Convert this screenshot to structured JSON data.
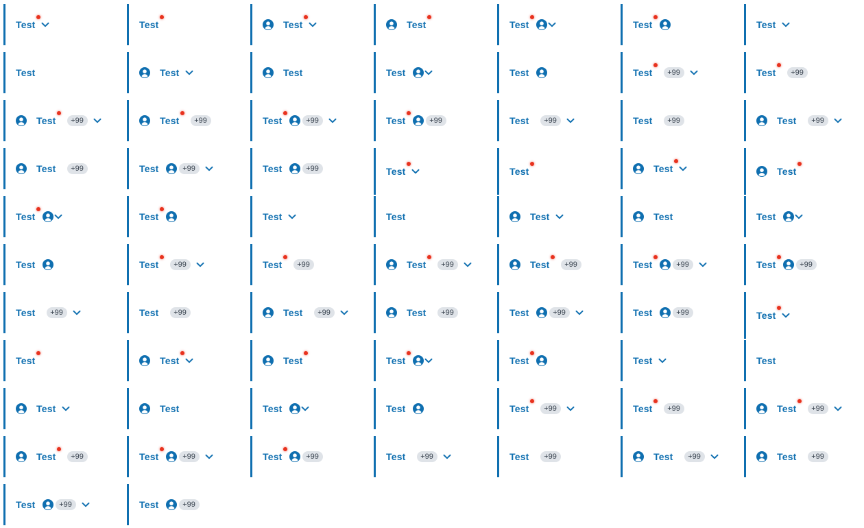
{
  "colors": {
    "accent": "#0f6fb0",
    "notification_dot": "#e8321e",
    "badge_bg": "#dfe3e8",
    "badge_text": "#3a4450"
  },
  "icons": {
    "avatar": "user-avatar-icon",
    "chevron": "chevron-down-icon",
    "dot": "notification-dot"
  },
  "tabs": [
    {
      "label": "Test",
      "dot": true,
      "avatar": null,
      "badge": null,
      "chevron": true
    },
    {
      "label": "Test",
      "dot": true,
      "avatar": null,
      "badge": null,
      "chevron": false
    },
    {
      "label": "Test",
      "dot": true,
      "avatar": "before",
      "badge": null,
      "chevron": true
    },
    {
      "label": "Test",
      "dot": true,
      "avatar": "before",
      "badge": null,
      "chevron": false
    },
    {
      "label": "Test",
      "dot": true,
      "avatar": "after",
      "badge": null,
      "chevron": true
    },
    {
      "label": "Test",
      "dot": true,
      "avatar": "after",
      "badge": null,
      "chevron": false
    },
    {
      "label": "Test",
      "dot": false,
      "avatar": null,
      "badge": null,
      "chevron": true
    },
    {
      "label": "Test",
      "dot": false,
      "avatar": null,
      "badge": null,
      "chevron": false
    },
    {
      "label": "Test",
      "dot": false,
      "avatar": "before",
      "badge": null,
      "chevron": true
    },
    {
      "label": "Test",
      "dot": false,
      "avatar": "before",
      "badge": null,
      "chevron": false
    },
    {
      "label": "Test",
      "dot": false,
      "avatar": "after",
      "badge": null,
      "chevron": true
    },
    {
      "label": "Test",
      "dot": false,
      "avatar": "after",
      "badge": null,
      "chevron": false
    },
    {
      "label": "Test",
      "dot": true,
      "avatar": null,
      "badge": "+99",
      "chevron": true
    },
    {
      "label": "Test",
      "dot": true,
      "avatar": null,
      "badge": "+99",
      "chevron": false
    },
    {
      "label": "Test",
      "dot": true,
      "avatar": "before",
      "badge": "+99",
      "chevron": true
    },
    {
      "label": "Test",
      "dot": true,
      "avatar": "before",
      "badge": "+99",
      "chevron": false
    },
    {
      "label": "Test",
      "dot": true,
      "avatar": "after",
      "badge": "+99",
      "chevron": true
    },
    {
      "label": "Test",
      "dot": true,
      "avatar": "after",
      "badge": "+99",
      "chevron": false
    },
    {
      "label": "Test",
      "dot": false,
      "avatar": null,
      "badge": "+99",
      "chevron": true
    },
    {
      "label": "Test",
      "dot": false,
      "avatar": null,
      "badge": "+99",
      "chevron": false
    },
    {
      "label": "Test",
      "dot": false,
      "avatar": "before",
      "badge": "+99",
      "chevron": true
    },
    {
      "label": "Test",
      "dot": false,
      "avatar": "before",
      "badge": "+99",
      "chevron": false
    },
    {
      "label": "Test",
      "dot": false,
      "avatar": "after",
      "badge": "+99",
      "chevron": true
    },
    {
      "label": "Test",
      "dot": false,
      "avatar": "after",
      "badge": "+99",
      "chevron": false
    },
    {
      "label": "Test",
      "dot": true,
      "avatar": null,
      "badge": null,
      "chevron": true
    },
    {
      "label": "Test",
      "dot": true,
      "avatar": null,
      "badge": null,
      "chevron": false
    },
    {
      "label": "Test",
      "dot": true,
      "avatar": "before",
      "badge": null,
      "chevron": true
    },
    {
      "label": "Test",
      "dot": true,
      "avatar": "before",
      "badge": null,
      "chevron": false
    },
    {
      "label": "Test",
      "dot": true,
      "avatar": "after",
      "badge": null,
      "chevron": true
    },
    {
      "label": "Test",
      "dot": true,
      "avatar": "after",
      "badge": null,
      "chevron": false
    },
    {
      "label": "Test",
      "dot": false,
      "avatar": null,
      "badge": null,
      "chevron": true
    },
    {
      "label": "Test",
      "dot": false,
      "avatar": null,
      "badge": null,
      "chevron": false
    },
    {
      "label": "Test",
      "dot": false,
      "avatar": "before",
      "badge": null,
      "chevron": true
    },
    {
      "label": "Test",
      "dot": false,
      "avatar": "before",
      "badge": null,
      "chevron": false
    },
    {
      "label": "Test",
      "dot": false,
      "avatar": "after",
      "badge": null,
      "chevron": true
    },
    {
      "label": "Test",
      "dot": false,
      "avatar": "after",
      "badge": null,
      "chevron": false
    },
    {
      "label": "Test",
      "dot": true,
      "avatar": null,
      "badge": "+99",
      "chevron": true
    },
    {
      "label": "Test",
      "dot": true,
      "avatar": null,
      "badge": "+99",
      "chevron": false
    },
    {
      "label": "Test",
      "dot": true,
      "avatar": "before",
      "badge": "+99",
      "chevron": true
    },
    {
      "label": "Test",
      "dot": true,
      "avatar": "before",
      "badge": "+99",
      "chevron": false
    },
    {
      "label": "Test",
      "dot": true,
      "avatar": "after",
      "badge": "+99",
      "chevron": true
    },
    {
      "label": "Test",
      "dot": true,
      "avatar": "after",
      "badge": "+99",
      "chevron": false
    },
    {
      "label": "Test",
      "dot": false,
      "avatar": null,
      "badge": "+99",
      "chevron": true
    },
    {
      "label": "Test",
      "dot": false,
      "avatar": null,
      "badge": "+99",
      "chevron": false
    },
    {
      "label": "Test",
      "dot": false,
      "avatar": "before",
      "badge": "+99",
      "chevron": true
    },
    {
      "label": "Test",
      "dot": false,
      "avatar": "before",
      "badge": "+99",
      "chevron": false
    },
    {
      "label": "Test",
      "dot": false,
      "avatar": "after",
      "badge": "+99",
      "chevron": true
    },
    {
      "label": "Test",
      "dot": false,
      "avatar": "after",
      "badge": "+99",
      "chevron": false
    },
    {
      "label": "Test",
      "dot": true,
      "avatar": null,
      "badge": null,
      "chevron": true
    },
    {
      "label": "Test",
      "dot": true,
      "avatar": null,
      "badge": null,
      "chevron": false
    },
    {
      "label": "Test",
      "dot": true,
      "avatar": "before",
      "badge": null,
      "chevron": true
    },
    {
      "label": "Test",
      "dot": true,
      "avatar": "before",
      "badge": null,
      "chevron": false
    },
    {
      "label": "Test",
      "dot": true,
      "avatar": "after",
      "badge": null,
      "chevron": true
    },
    {
      "label": "Test",
      "dot": true,
      "avatar": "after",
      "badge": null,
      "chevron": false
    },
    {
      "label": "Test",
      "dot": false,
      "avatar": null,
      "badge": null,
      "chevron": true
    },
    {
      "label": "Test",
      "dot": false,
      "avatar": null,
      "badge": null,
      "chevron": false
    },
    {
      "label": "Test",
      "dot": false,
      "avatar": "before",
      "badge": null,
      "chevron": true
    },
    {
      "label": "Test",
      "dot": false,
      "avatar": "before",
      "badge": null,
      "chevron": false
    },
    {
      "label": "Test",
      "dot": false,
      "avatar": "after",
      "badge": null,
      "chevron": true
    },
    {
      "label": "Test",
      "dot": false,
      "avatar": "after",
      "badge": null,
      "chevron": false
    },
    {
      "label": "Test",
      "dot": true,
      "avatar": null,
      "badge": "+99",
      "chevron": true
    },
    {
      "label": "Test",
      "dot": true,
      "avatar": null,
      "badge": "+99",
      "chevron": false
    },
    {
      "label": "Test",
      "dot": true,
      "avatar": "before",
      "badge": "+99",
      "chevron": true
    },
    {
      "label": "Test",
      "dot": true,
      "avatar": "before",
      "badge": "+99",
      "chevron": false
    },
    {
      "label": "Test",
      "dot": true,
      "avatar": "after",
      "badge": "+99",
      "chevron": true
    },
    {
      "label": "Test",
      "dot": true,
      "avatar": "after",
      "badge": "+99",
      "chevron": false
    },
    {
      "label": "Test",
      "dot": false,
      "avatar": null,
      "badge": "+99",
      "chevron": true
    },
    {
      "label": "Test",
      "dot": false,
      "avatar": null,
      "badge": "+99",
      "chevron": false
    },
    {
      "label": "Test",
      "dot": false,
      "avatar": "before",
      "badge": "+99",
      "chevron": true
    },
    {
      "label": "Test",
      "dot": false,
      "avatar": "before",
      "badge": "+99",
      "chevron": false
    },
    {
      "label": "Test",
      "dot": false,
      "avatar": "after",
      "badge": "+99",
      "chevron": true
    },
    {
      "label": "Test",
      "dot": false,
      "avatar": "after",
      "badge": "+99",
      "chevron": false
    }
  ]
}
